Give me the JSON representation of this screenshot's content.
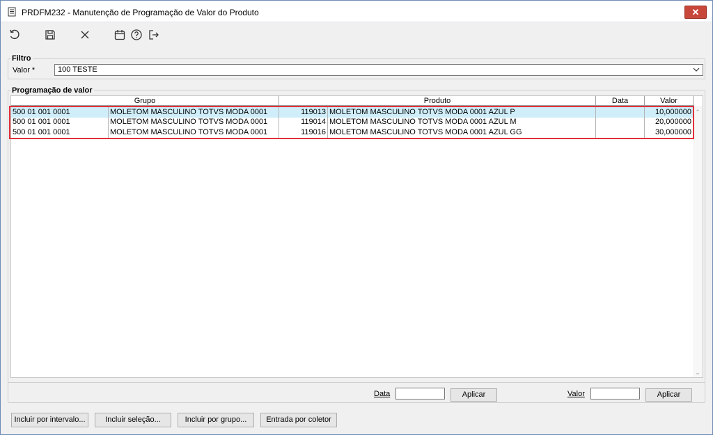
{
  "window": {
    "title": "PRDFM232 - Manutenção de Programação de Valor do Produto",
    "close_glyph": "✕"
  },
  "toolbar": {
    "buttons": [
      {
        "icon": "undo-icon"
      },
      {
        "icon": "save-icon"
      },
      {
        "icon": "close-icon"
      },
      {
        "icon": "calendar-icon"
      },
      {
        "icon": "help-icon"
      },
      {
        "icon": "exit-icon"
      }
    ]
  },
  "filtro": {
    "legend": "Filtro",
    "valor_label": "Valor *",
    "valor_value": "100 TESTE"
  },
  "programacao": {
    "legend": "Programação de valor",
    "columns": [
      "Grupo",
      "Produto",
      "Data",
      "Valor"
    ],
    "rows": [
      {
        "grupo_code": "500 01 001 0001",
        "grupo_desc": "MOLETOM MASCULINO TOTVS MODA 0001",
        "produto_code": "119013",
        "produto_desc": "MOLETOM MASCULINO TOTVS MODA 0001 AZUL P",
        "data": "",
        "valor": "10,000000"
      },
      {
        "grupo_code": "500 01 001 0001",
        "grupo_desc": "MOLETOM MASCULINO TOTVS MODA 0001",
        "produto_code": "119014",
        "produto_desc": "MOLETOM MASCULINO TOTVS MODA 0001 AZUL M",
        "data": "",
        "valor": "20,000000"
      },
      {
        "grupo_code": "500 01 001 0001",
        "grupo_desc": "MOLETOM MASCULINO TOTVS MODA 0001",
        "produto_code": "119016",
        "produto_desc": "MOLETOM MASCULINO TOTVS MODA 0001 AZUL GG",
        "data": "",
        "valor": "30,000000"
      }
    ]
  },
  "apply_bar": {
    "data_label": "Data",
    "valor_label": "Valor",
    "aplicar_label": "Aplicar"
  },
  "actions": {
    "incluir_intervalo": "Incluir por intervalo...",
    "incluir_selecao": "Incluir seleção...",
    "incluir_grupo": "Incluir por grupo...",
    "entrada_coletor": "Entrada por coletor"
  },
  "colors": {
    "selected_row": "#cfeefa",
    "highlight_box": "#e0313a",
    "close_button": "#c7473a"
  }
}
